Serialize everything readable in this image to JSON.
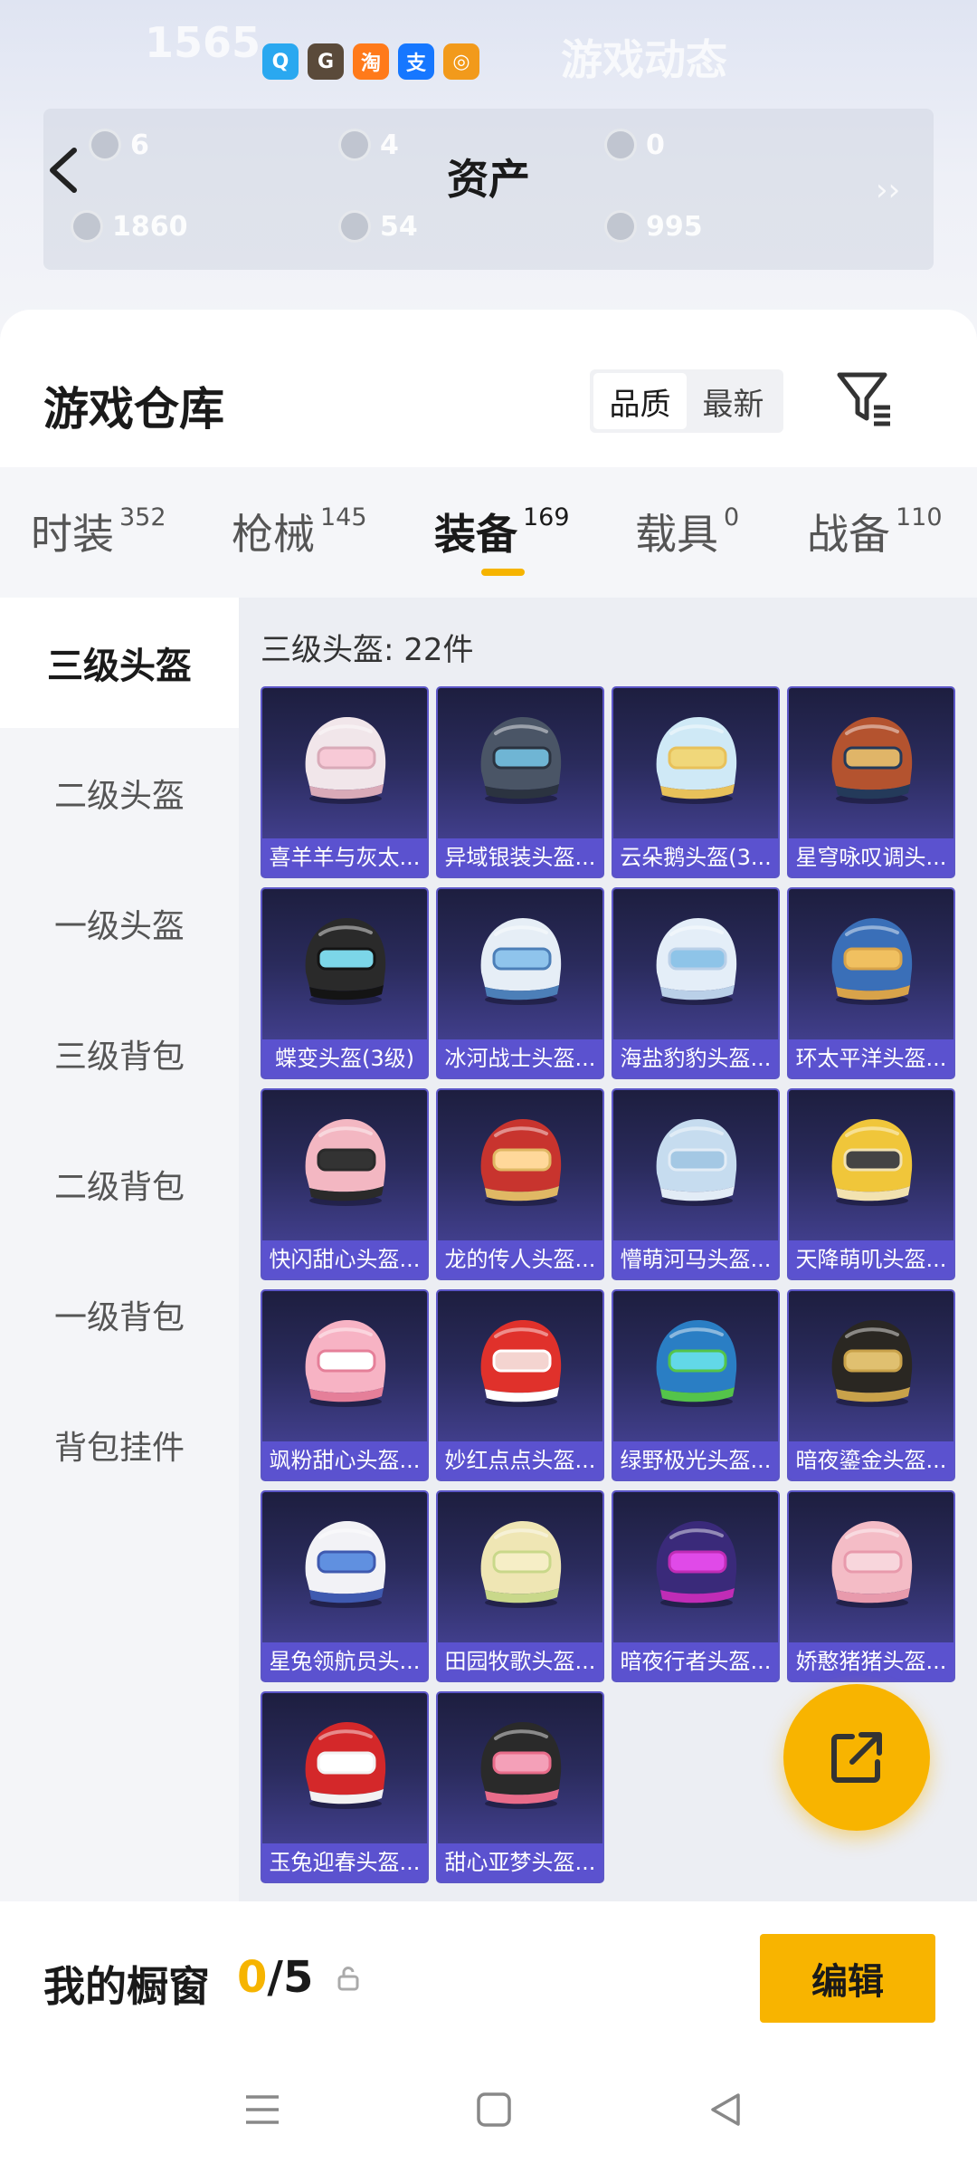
{
  "hero": {
    "faded_left": "1565",
    "faded_right": "游戏动态",
    "app_icons": [
      {
        "name": "qq-icon",
        "glyph": "Q",
        "color": "#2aa8f0"
      },
      {
        "name": "game-icon",
        "glyph": "G",
        "color": "#5a4a3a"
      },
      {
        "name": "taobao-icon",
        "glyph": "淘",
        "color": "#ff7a1a"
      },
      {
        "name": "alipay-icon",
        "glyph": "支",
        "color": "#1677ff"
      },
      {
        "name": "target-icon",
        "glyph": "◎",
        "color": "#f29a1b"
      }
    ]
  },
  "assets": {
    "title": "资产",
    "items": [
      {
        "value": "6"
      },
      {
        "value": "4"
      },
      {
        "value": "0"
      },
      {
        "value": "1860"
      },
      {
        "value": "54"
      },
      {
        "value": "995"
      }
    ]
  },
  "warehouse": {
    "title": "游戏仓库",
    "sort_options": [
      "品质",
      "最新"
    ],
    "sort_active": "品质"
  },
  "tabs": [
    {
      "label": "时装",
      "count": "352"
    },
    {
      "label": "枪械",
      "count": "145"
    },
    {
      "label": "装备",
      "count": "169"
    },
    {
      "label": "载具",
      "count": "0"
    },
    {
      "label": "战备",
      "count": "110"
    }
  ],
  "active_tab": "装备",
  "sidebar": [
    {
      "label": "三级头盔"
    },
    {
      "label": "二级头盔"
    },
    {
      "label": "一级头盔"
    },
    {
      "label": "三级背包"
    },
    {
      "label": "二级背包"
    },
    {
      "label": "一级背包"
    },
    {
      "label": "背包挂件"
    }
  ],
  "content": {
    "title": "三级头盔: 22件",
    "items": [
      {
        "name": "喜羊羊与灰太...",
        "c1": "#f1e6ea",
        "c2": "#d9aab8",
        "visor": "#f7c9d6"
      },
      {
        "name": "异域银装头盔...",
        "c1": "#4a5566",
        "c2": "#2b3340",
        "visor": "#6fb5d4"
      },
      {
        "name": "云朵鹅头盔(3...",
        "c1": "#cfe9f6",
        "c2": "#e8c15a",
        "visor": "#f0d77a"
      },
      {
        "name": "星穹咏叹调头...",
        "c1": "#b4532f",
        "c2": "#243a5a",
        "visor": "#e0b568"
      },
      {
        "name": "蝶变头盔(3级)",
        "c1": "#2a2a2a",
        "c2": "#141414",
        "visor": "#7cd6e8"
      },
      {
        "name": "冰河战士头盔...",
        "c1": "#e6eef6",
        "c2": "#4c7fb8",
        "visor": "#8fc4ec"
      },
      {
        "name": "海盐豹豹头盔...",
        "c1": "#e4eef8",
        "c2": "#bad0e8",
        "visor": "#8ec4e8"
      },
      {
        "name": "环太平洋头盔...",
        "c1": "#3a6fb8",
        "c2": "#d8a34a",
        "visor": "#f0c060"
      },
      {
        "name": "快闪甜心头盔...",
        "c1": "#f3b7c2",
        "c2": "#2a2a2a",
        "visor": "#333333"
      },
      {
        "name": "龙的传人头盔...",
        "c1": "#c8342e",
        "c2": "#e0b864",
        "visor": "#ffd89a"
      },
      {
        "name": "懵萌河马头盔...",
        "c1": "#c6dcef",
        "c2": "#e2ecf6",
        "visor": "#a4c8e4"
      },
      {
        "name": "天降萌叽头盔...",
        "c1": "#f0c63a",
        "c2": "#f2e2b0",
        "visor": "#444444"
      },
      {
        "name": "飒粉甜心头盔...",
        "c1": "#f7b3c4",
        "c2": "#e57f99",
        "visor": "#ffffff"
      },
      {
        "name": "妙红点点头盔...",
        "c1": "#e0312b",
        "c2": "#ffffff",
        "visor": "#f4d4d0"
      },
      {
        "name": "绿野极光头盔...",
        "c1": "#2a7ec4",
        "c2": "#54c44a",
        "visor": "#62d8e8"
      },
      {
        "name": "暗夜鎏金头盔...",
        "c1": "#2a2722",
        "c2": "#c9a24a",
        "visor": "#e0c070"
      },
      {
        "name": "星兔领航员头...",
        "c1": "#f2f2f6",
        "c2": "#3f5ab0",
        "visor": "#6090e0"
      },
      {
        "name": "田园牧歌头盔...",
        "c1": "#efe6b4",
        "c2": "#c9d88a",
        "visor": "#f6eec6"
      },
      {
        "name": "暗夜行者头盔...",
        "c1": "#3a2a7a",
        "c2": "#c02cb6",
        "visor": "#e04ae8"
      },
      {
        "name": "娇憨猪猪头盔...",
        "c1": "#f4bcc6",
        "c2": "#e89aac",
        "visor": "#f8d6dc"
      },
      {
        "name": "玉兔迎春头盔...",
        "c1": "#d4282a",
        "c2": "#f2f2f2",
        "visor": "#ffffff"
      },
      {
        "name": "甜心亚梦头盔...",
        "c1": "#2a2a2a",
        "c2": "#e86c8a",
        "visor": "#f4a0b8"
      }
    ]
  },
  "showcase": {
    "label": "我的橱窗",
    "current": "0",
    "sep_total": "/5",
    "edit_label": "编辑"
  },
  "accent_color": "#f8b400"
}
